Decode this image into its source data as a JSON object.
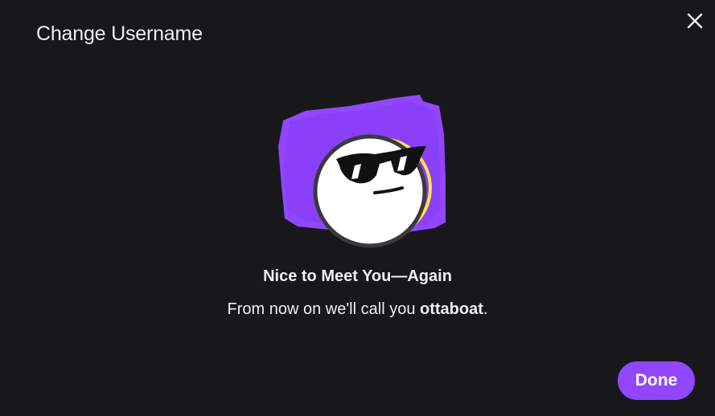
{
  "dialog": {
    "title": "Change Username",
    "close_icon": "close-icon",
    "illustration_icon": "sunglasses-face-icon",
    "heading": "Nice to Meet You—Again",
    "message_prefix": "From now on we'll call you ",
    "username": "ottaboat",
    "message_suffix": ".",
    "done_label": "Done"
  },
  "colors": {
    "background": "#18181b",
    "accent": "#9147ff",
    "highlight": "#ffe14d",
    "text": "#efeff1"
  }
}
